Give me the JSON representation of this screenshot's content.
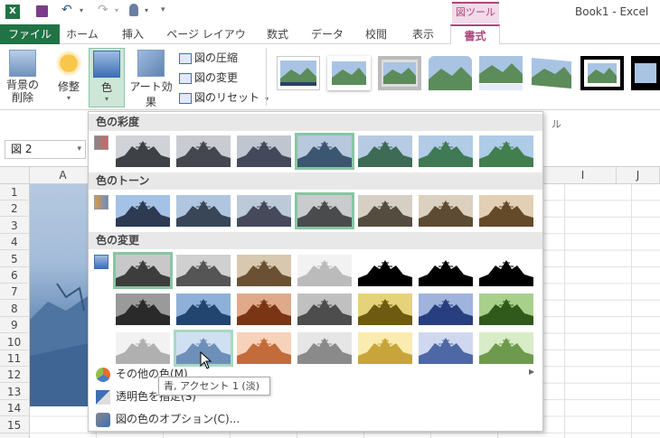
{
  "title": "Book1 - Excel",
  "context_tab": "図ツール",
  "tabs": [
    "ファイル",
    "ホーム",
    "挿入",
    "ページ レイアウト",
    "数式",
    "データ",
    "校閲",
    "表示",
    "書式"
  ],
  "ribbon": {
    "remove_bg_1": "背景の",
    "remove_bg_2": "削除",
    "corrections": "修整",
    "color": "色",
    "artistic": "アート効果",
    "compress": "図の圧縮",
    "change": "図の変更",
    "reset": "図のリセット",
    "group_label_fragment": "ル"
  },
  "namebox": "図 2",
  "columns": [
    "A",
    "I",
    "J"
  ],
  "rows": [
    "1",
    "2",
    "3",
    "4",
    "5",
    "6",
    "7",
    "8",
    "9",
    "10",
    "11",
    "12",
    "13",
    "14",
    "15"
  ],
  "dropdown": {
    "saturation_title": "色の彩度",
    "tone_title": "色のトーン",
    "recolor_title": "色の変更",
    "more_colors": "その他の色(M)",
    "transparent": "透明色を指定(S)",
    "options": "図の色のオプション(C)..."
  },
  "tooltip": "青, アクセント 1 (淡)",
  "colors": {
    "excel_green": "#217346",
    "context_pink": "#b0437b",
    "selection_green": "#86c6a3"
  }
}
